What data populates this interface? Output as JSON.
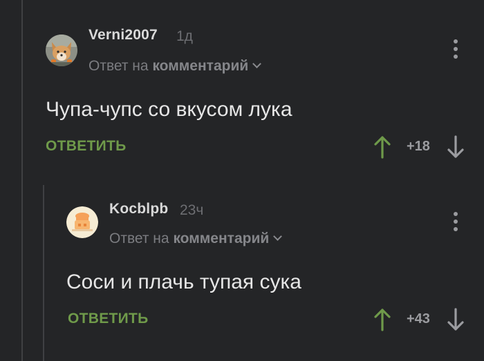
{
  "colors": {
    "background": "#242527",
    "upvote": "#6f9a4a",
    "reply_button": "#6f9a4a",
    "text": "#e6e6e6",
    "muted": "#7b7c80"
  },
  "comments": [
    {
      "author": "Verni2007",
      "time": "1д",
      "reply_prefix": "Ответ на",
      "reply_target": "комментарий",
      "text": "Чупа-чупс со вкусом лука",
      "reply_label": "ОТВЕТИТЬ",
      "rating": "+18",
      "avatar_icon": "fox-avatar-icon"
    },
    {
      "author": "Kocblpb",
      "time": "23ч",
      "reply_prefix": "Ответ на",
      "reply_target": "комментарий",
      "text": "Соси и плачь тупая сука",
      "reply_label": "ОТВЕТИТЬ",
      "rating": "+43",
      "avatar_icon": "chef-avatar-icon"
    }
  ]
}
